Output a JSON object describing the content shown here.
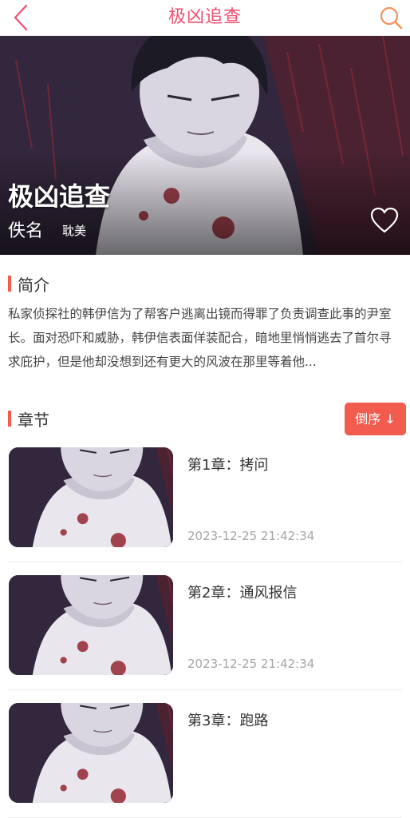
{
  "header": {
    "title": "极凶追查"
  },
  "banner": {
    "title": "极凶追查",
    "author": "佚名",
    "tag": "耽美"
  },
  "intro": {
    "label": "简介",
    "text": "私家侦探社的韩伊信为了帮客户逃离出镜而得罪了负责调查此事的尹室长。面对恐吓和威胁，韩伊信表面佯装配合，暗地里悄悄逃去了首尔寻求庇护，但是他却没想到还有更大的风波在那里等着他..."
  },
  "chapters_section": {
    "label": "章节",
    "order_button": "倒序 ↓"
  },
  "chapters": [
    {
      "title": "第1章：拷问",
      "date": "2023-12-25 21:42:34"
    },
    {
      "title": "第2章：通风报信",
      "date": "2023-12-25 21:42:34"
    },
    {
      "title": "第3章：跑路",
      "date": ""
    }
  ],
  "colors": {
    "accent": "#f0506e",
    "button": "#f15c4f",
    "search_icon": "#f2925a"
  },
  "icons": {
    "back": "chevron-left-icon",
    "search": "search-icon",
    "favorite": "heart-outline-icon"
  }
}
